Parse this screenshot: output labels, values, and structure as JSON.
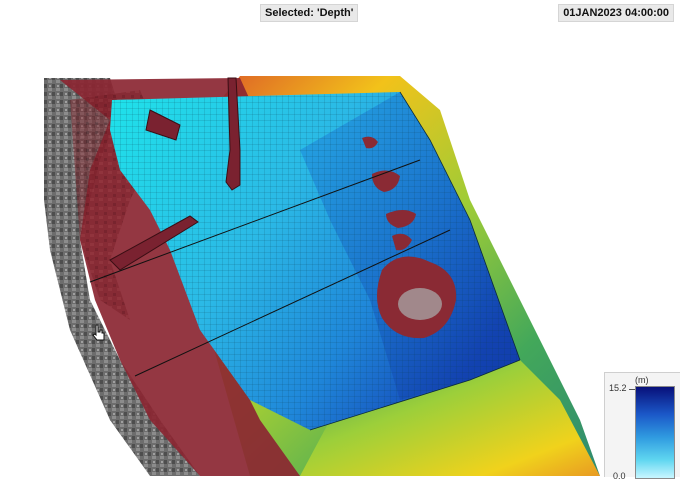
{
  "header": {
    "selected_label": "Selected: 'Depth'",
    "timestamp": "01JAN2023 04:00:00"
  },
  "map": {
    "dataset": "Depth",
    "icons": [
      "hand-cursor-icon"
    ]
  },
  "legend": {
    "unit": "(m)",
    "max": "15.2",
    "min": "0.0",
    "colors": [
      "#08107a",
      "#1b58c8",
      "#2f9ae0",
      "#5fd6f0",
      "#c8f6ff"
    ]
  }
}
